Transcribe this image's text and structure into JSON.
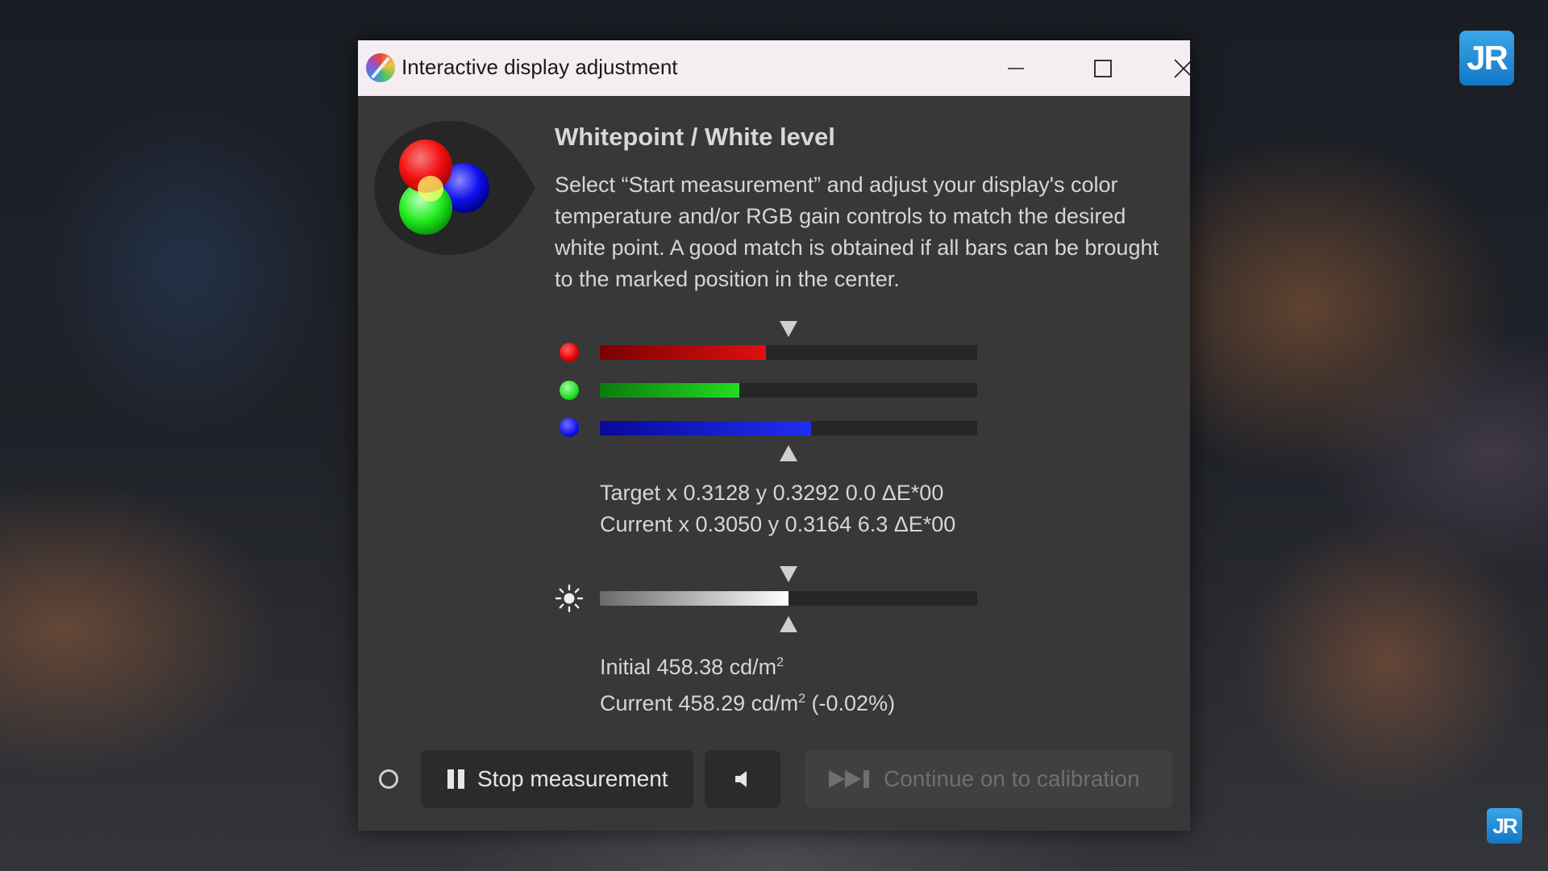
{
  "window": {
    "title": "Interactive display adjustment"
  },
  "content": {
    "heading": "Whitepoint / White level",
    "description": "Select “Start measurement” and adjust your display's color temperature and/or RGB gain controls to match the desired white point. A good match is obtained if all bars can be brought to the marked position in the center."
  },
  "rgb_bars": [
    {
      "channel": "red",
      "fill_fraction": 0.44,
      "color": "#e01010"
    },
    {
      "channel": "green",
      "fill_fraction": 0.37,
      "color": "#22dd22"
    },
    {
      "channel": "blue",
      "fill_fraction": 0.56,
      "color": "#1f2ff0"
    }
  ],
  "whitepoint_readout": {
    "target": "Target x 0.3128 y 0.3292 0.0 ΔE*00",
    "current": "Current x 0.3050 y 0.3164 6.3 ΔE*00"
  },
  "luminance_bar": {
    "fill_fraction": 0.5
  },
  "luminance_readout": {
    "initial": "Initial 458.38 cd/m",
    "initial_sup": "2",
    "current": "Current 458.29 cd/m",
    "current_sup": "2",
    "current_suffix": " (-0.02%)"
  },
  "buttons": {
    "stop": "Stop measurement",
    "continue": "Continue on to calibration"
  },
  "icons": {
    "minimize": "minimize-icon",
    "maximize": "maximize-icon",
    "close": "close-icon",
    "brightness": "sun-icon",
    "pause": "pause-icon",
    "speaker": "speaker-icon",
    "skip": "skip-forward-icon"
  },
  "colors": {
    "window_bg": "#383838",
    "titlebar_bg": "#f4eef2",
    "accent_blue": "#1277c4"
  }
}
